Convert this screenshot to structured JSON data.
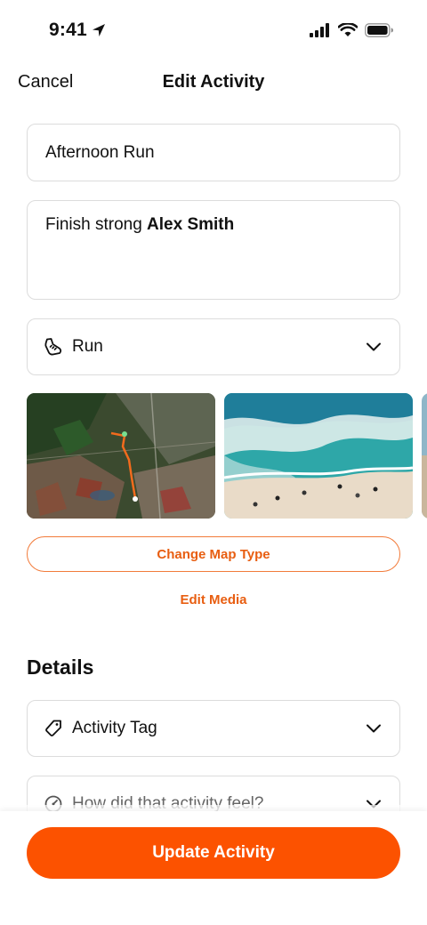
{
  "status_bar": {
    "time": "9:41"
  },
  "nav": {
    "cancel_label": "Cancel",
    "title": "Edit Activity"
  },
  "form": {
    "title_value": "Afternoon Run",
    "description_text": "Finish strong ",
    "description_mention": "Alex Smith",
    "sport_type": "Run",
    "sport_icon": "shoe-icon"
  },
  "media": {
    "items": [
      "map-thumbnail",
      "beach-photo",
      "partial-thumbnail"
    ]
  },
  "actions": {
    "change_map_type_label": "Change Map Type",
    "edit_media_label": "Edit Media",
    "update_label": "Update Activity"
  },
  "details": {
    "section_title": "Details",
    "activity_tag_label": "Activity Tag",
    "feel_placeholder": "How did that activity feel?"
  },
  "colors": {
    "accent": "#fc5200",
    "link": "#e85e11",
    "border": "#dcdcdc"
  }
}
